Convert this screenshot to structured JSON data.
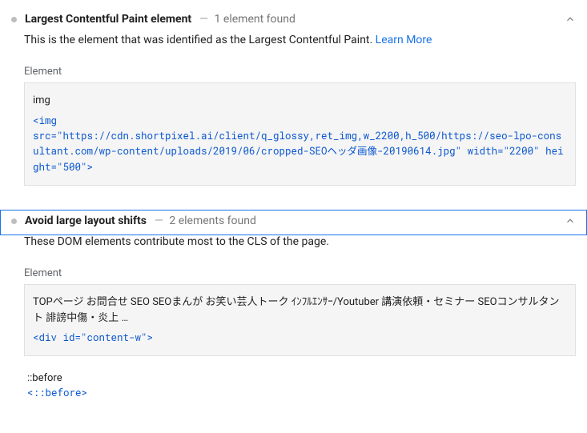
{
  "audits": [
    {
      "title": "Largest Contentful Paint element",
      "count_text": "1 element found",
      "description_prefix": "This is the element that was identified as the Largest Contentful Paint. ",
      "learn_more": "Learn More",
      "table_header": "Element",
      "element_label": "img",
      "element_snippet": "<img\nsrc=\"https://cdn.shortpixel.ai/client/q_glossy,ret_img,w_2200,h_500/https://seo-lpo-consultant.com/wp-content/uploads/2019/06/cropped-SEOヘッダ画像-20190614.jpg\" width=\"2200\" height=\"500\">"
    },
    {
      "title": "Avoid large layout shifts",
      "count_text": "2 elements found",
      "description": "These DOM elements contribute most to the CLS of the page.",
      "table_header": "Element",
      "element_label": "TOPページ お問合せ SEO SEOまんが お笑い芸人トーク ｲﾝﾌﾙｴﾝｻｰ/Youtuber 講演依頼・セミナー SEOコンサルタント 誹謗中傷・炎上 …",
      "element_snippet": "<div id=\"content-w\">",
      "row2_label": "::before",
      "row2_snippet": "<::before>"
    }
  ]
}
